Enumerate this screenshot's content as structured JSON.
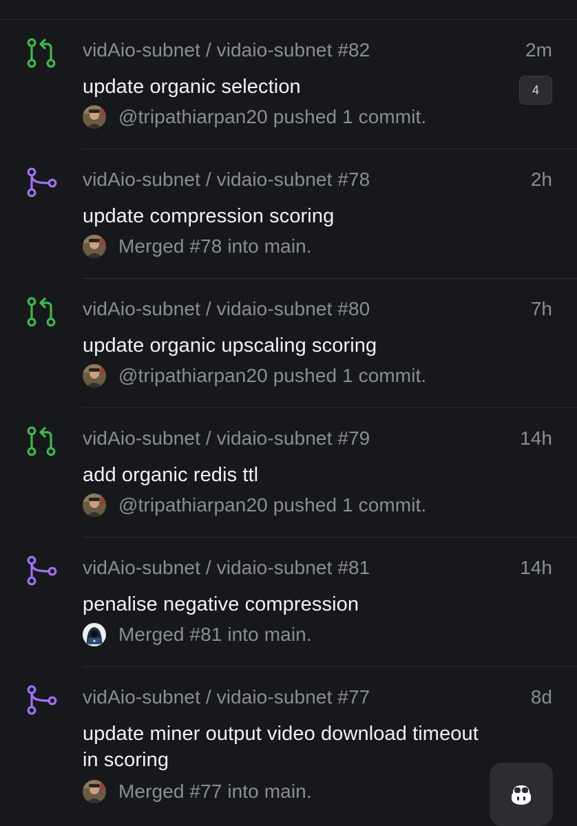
{
  "colors": {
    "background": "#17181b",
    "divider": "#2d2f34",
    "muted_text": "#8a8d94",
    "primary_text": "#f2f3f5",
    "open_pr_green": "#3fb950",
    "merged_purple": "#a371f7"
  },
  "feed": {
    "items": [
      {
        "icon": "pull-request-open-icon",
        "repo": "vidAio-subnet / vidaio-subnet #82",
        "time": "2m",
        "title": "update organic selection",
        "meta": "@tripathiarpan20 pushed 1 commit.",
        "avatar": "user-photo-avatar",
        "badge": "4"
      },
      {
        "icon": "pull-request-merged-icon",
        "repo": "vidAio-subnet / vidaio-subnet #78",
        "time": "2h",
        "title": "update compression scoring",
        "meta": "Merged #78 into main.",
        "avatar": "user-photo-avatar"
      },
      {
        "icon": "pull-request-open-icon",
        "repo": "vidAio-subnet / vidaio-subnet #80",
        "time": "7h",
        "title": "update organic upscaling scoring",
        "meta": "@tripathiarpan20 pushed 1 commit.",
        "avatar": "user-photo-avatar"
      },
      {
        "icon": "pull-request-open-icon",
        "repo": "vidAio-subnet / vidaio-subnet #79",
        "time": "14h",
        "title": "add organic redis ttl",
        "meta": "@tripathiarpan20 pushed 1 commit.",
        "avatar": "user-photo-avatar"
      },
      {
        "icon": "pull-request-merged-icon",
        "repo": "vidAio-subnet / vidaio-subnet #81",
        "time": "14h",
        "title": "penalise negative compression",
        "meta": "Merged #81 into main.",
        "avatar": "hacker-avatar"
      },
      {
        "icon": "pull-request-merged-icon",
        "repo": "vidAio-subnet / vidaio-subnet #77",
        "time": "8d",
        "title": "update miner output video download timeout in scoring",
        "meta": "Merged #77 into main.",
        "avatar": "user-photo-avatar"
      }
    ]
  },
  "fab": {
    "icon": "copilot-icon"
  }
}
